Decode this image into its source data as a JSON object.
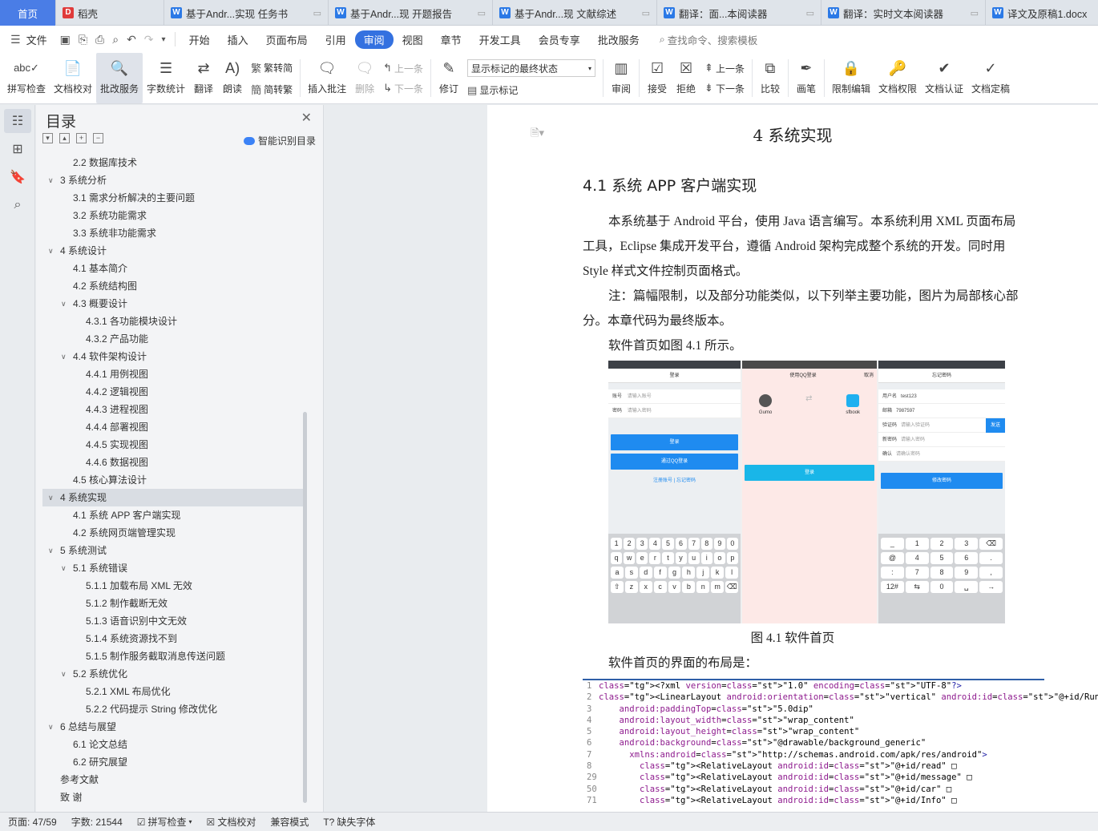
{
  "tabs": [
    {
      "label": "首页",
      "kind": "home"
    },
    {
      "label": "稻壳",
      "kind": "daoke"
    },
    {
      "label": "基于Andr...实现 任务书",
      "kind": "doc"
    },
    {
      "label": "基于Andr...现 开题报告",
      "kind": "doc"
    },
    {
      "label": "基于Andr...现 文献综述",
      "kind": "doc"
    },
    {
      "label": "翻译：面...本阅读器",
      "kind": "doc"
    },
    {
      "label": "翻译：实时文本阅读器",
      "kind": "doc"
    },
    {
      "label": "译文及原稿1.docx",
      "kind": "doc"
    }
  ],
  "menu": {
    "file": "文件",
    "items": [
      "开始",
      "插入",
      "页面布局",
      "引用",
      "审阅",
      "视图",
      "章节",
      "开发工具",
      "会员专享",
      "批改服务"
    ],
    "active": "审阅",
    "search": "查找命令、搜索模板"
  },
  "ribbon": {
    "spell": "拼写检查",
    "proof": "文档校对",
    "grading": "批改服务",
    "wordcount": "字数统计",
    "translate": "翻译",
    "read": "朗读",
    "trad2simp": "繁转简",
    "simp2trad": "简转繁",
    "insert_comment": "插入批注",
    "delete": "删除",
    "prev": "上一条",
    "next": "下一条",
    "revise": "修订",
    "markup_select": "显示标记的最终状态",
    "show_markup": "显示标记",
    "review": "审阅",
    "accept": "接受",
    "reject": "拒绝",
    "prev2": "上一条",
    "next2": "下一条",
    "compare": "比较",
    "pen": "画笔",
    "restrict": "限制编辑",
    "perm": "文档权限",
    "auth": "文档认证",
    "finalize": "文档定稿"
  },
  "toc": {
    "title": "目录",
    "smart": "智能识别目录",
    "items": [
      {
        "label": "2.2  数据库技术",
        "level": 2,
        "arrow": ""
      },
      {
        "label": "3 系统分析",
        "level": 1,
        "arrow": "v"
      },
      {
        "label": "3.1 需求分析解决的主要问题",
        "level": 2,
        "arrow": ""
      },
      {
        "label": "3.2 系统功能需求",
        "level": 2,
        "arrow": ""
      },
      {
        "label": "3.3 系统非功能需求",
        "level": 2,
        "arrow": ""
      },
      {
        "label": "4  系统设计",
        "level": 1,
        "arrow": "v"
      },
      {
        "label": "4.1 基本简介",
        "level": 2,
        "arrow": ""
      },
      {
        "label": "4.2 系统结构图",
        "level": 2,
        "arrow": ""
      },
      {
        "label": "4.3 概要设计",
        "level": 2,
        "arrow": "v"
      },
      {
        "label": "4.3.1 各功能模块设计",
        "level": 3,
        "arrow": ""
      },
      {
        "label": "4.3.2 产品功能",
        "level": 3,
        "arrow": ""
      },
      {
        "label": "4.4 软件架构设计",
        "level": 2,
        "arrow": "v"
      },
      {
        "label": "4.4.1 用例视图",
        "level": 3,
        "arrow": ""
      },
      {
        "label": "4.4.2 逻辑视图",
        "level": 3,
        "arrow": ""
      },
      {
        "label": "4.4.3 进程视图",
        "level": 3,
        "arrow": ""
      },
      {
        "label": "4.4.4 部署视图",
        "level": 3,
        "arrow": ""
      },
      {
        "label": "4.4.5 实现视图",
        "level": 3,
        "arrow": ""
      },
      {
        "label": "4.4.6 数据视图",
        "level": 3,
        "arrow": ""
      },
      {
        "label": "4.5 核心算法设计",
        "level": 2,
        "arrow": ""
      },
      {
        "label": "4 系统实现",
        "level": 1,
        "arrow": "v",
        "selected": true
      },
      {
        "label": "4.1 系统 APP 客户端实现",
        "level": 2,
        "arrow": ""
      },
      {
        "label": "4.2 系统网页端管理实现",
        "level": 2,
        "arrow": ""
      },
      {
        "label": "5 系统测试",
        "level": 1,
        "arrow": "v"
      },
      {
        "label": "5.1 系统错误",
        "level": 2,
        "arrow": "v"
      },
      {
        "label": "5.1.1 加载布局 XML 无效",
        "level": 3,
        "arrow": ""
      },
      {
        "label": "5.1.2 制作截断无效",
        "level": 3,
        "arrow": ""
      },
      {
        "label": "5.1.3 语音识别中文无效",
        "level": 3,
        "arrow": ""
      },
      {
        "label": "5.1.4 系统资源找不到",
        "level": 3,
        "arrow": ""
      },
      {
        "label": "5.1.5 制作服务截取消息传送问题",
        "level": 3,
        "arrow": ""
      },
      {
        "label": "5.2 系统优化",
        "level": 2,
        "arrow": "v"
      },
      {
        "label": "5.2.1 XML 布局优化",
        "level": 3,
        "arrow": ""
      },
      {
        "label": "5.2.2 代码提示 String 修改优化",
        "level": 3,
        "arrow": ""
      },
      {
        "label": "6 总结与展望",
        "level": 1,
        "arrow": "v"
      },
      {
        "label": "6.1 论文总结",
        "level": 2,
        "arrow": ""
      },
      {
        "label": "6.2 研究展望",
        "level": 2,
        "arrow": ""
      },
      {
        "label": "参考文献",
        "level": 1,
        "arrow": ""
      },
      {
        "label": "致    谢",
        "level": 1,
        "arrow": ""
      }
    ]
  },
  "doc": {
    "chapter": "4 系统实现",
    "section": "4.1 系统 APP 客户端实现",
    "p1": "本系统基于 Android 平台，使用 Java 语言编写。本系统利用 XML 页面布局工具，Eclipse 集成开发平台，遵循 Android 架构完成整个系统的开发。同时用 Style 样式文件控制页面格式。",
    "p2": "注：篇幅限制，以及部分功能类似，以下列举主要功能，图片为局部核心部分。本章代码为最终版本。",
    "p3": "软件首页如图 4.1 所示。",
    "caption": "图 4.1  软件首页",
    "p4": "软件首页的界面的布局是：",
    "phones": {
      "login_title": "登录",
      "account": "账号",
      "account_ph": "请输入账号",
      "password": "密码",
      "password_ph": "请输入密码",
      "login_btn": "登录",
      "qq_btn": "通过QQ登录",
      "register": "注册账号",
      "forgot": "忘记密码",
      "qq_title": "使用QQ登录",
      "qq_cancel": "取消",
      "qq_user": "Gumo",
      "qq_app": "sfbook",
      "qq_login": "登录",
      "fp_title": "忘记密码",
      "fp_user_label": "用户名",
      "fp_user": "test123",
      "fp_mail_label": "邮箱",
      "fp_mail": "7987597",
      "fp_code": "验证码",
      "fp_code_ph": "请输入验证码",
      "fp_send": "发送",
      "fp_newpw": "新密码",
      "fp_newpw_ph": "请输入密码",
      "fp_confirm": "确认",
      "fp_confirm_ph": "请确认密码",
      "fp_btn": "修改密码"
    },
    "code": [
      {
        "n": "1",
        "t": "<?xml version=\"1.0\" encoding=\"UTF-8\"?>"
      },
      {
        "n": "2",
        "t": "<LinearLayout android:orientation=\"vertical\" android:id=\"@+id/Run\""
      },
      {
        "n": "3",
        "t": "    android:paddingTop=\"5.0dip\""
      },
      {
        "n": "4",
        "t": "    android:layout_width=\"wrap_content\""
      },
      {
        "n": "5",
        "t": "    android:layout_height=\"wrap_content\""
      },
      {
        "n": "6",
        "t": "    android:background=\"@drawable/background_generic\""
      },
      {
        "n": "7",
        "t": "      xmlns:android=\"http://schemas.android.com/apk/res/android\">"
      },
      {
        "n": "8",
        "t": "        <RelativeLayout android:id=\"@+id/read\" □"
      },
      {
        "n": "29",
        "t": "        <RelativeLayout android:id=\"@+id/message\" □"
      },
      {
        "n": "50",
        "t": "        <RelativeLayout android:id=\"@+id/car\" □"
      },
      {
        "n": "71",
        "t": "        <RelativeLayout android:id=\"@+id/Info\" □"
      }
    ]
  },
  "status": {
    "page": "页面: 47/59",
    "words": "字数: 21544",
    "spell": "拼写检查",
    "proof": "文档校对",
    "compat": "兼容模式",
    "missing_font": "缺失字体"
  }
}
